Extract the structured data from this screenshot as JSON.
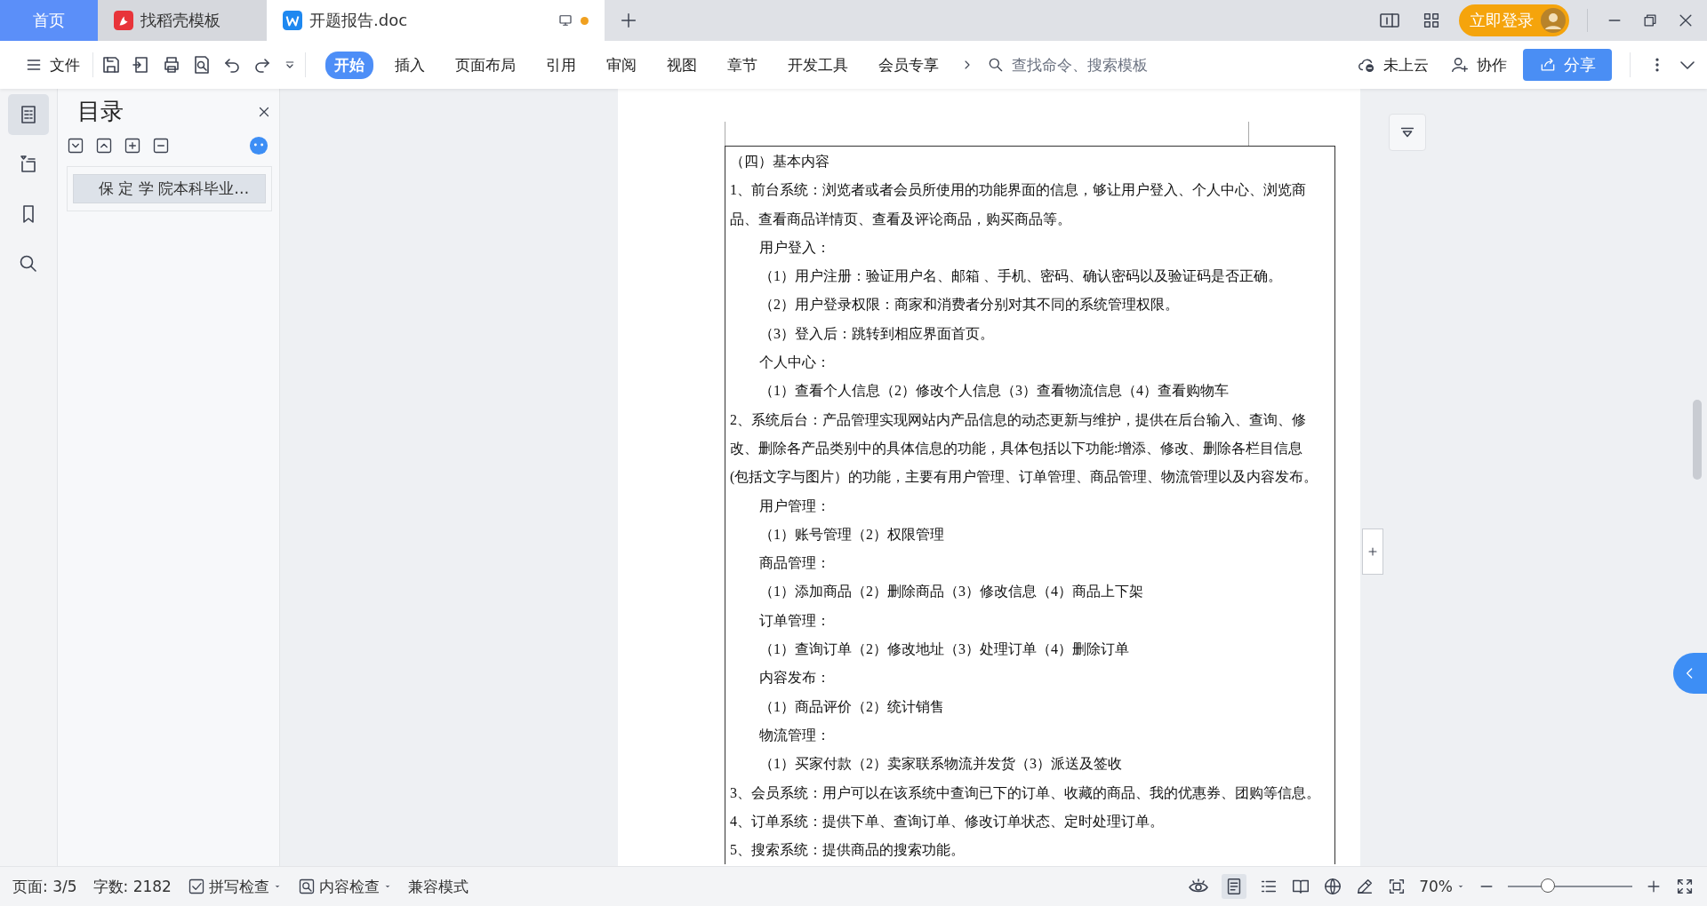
{
  "tabs": [
    {
      "label": "首页",
      "kind": "home",
      "selected": false
    },
    {
      "label": "找稻壳模板",
      "kind": "template",
      "selected": false
    },
    {
      "label": "开题报告.doc",
      "kind": "doc",
      "selected": true,
      "unsaved": true
    }
  ],
  "title_bar": {
    "login_button": "立即登录"
  },
  "toolbar": {
    "file_menu": "文件",
    "ribbon_tabs": [
      {
        "label": "开始",
        "selected": true
      },
      {
        "label": "插入",
        "selected": false
      },
      {
        "label": "页面布局",
        "selected": false
      },
      {
        "label": "引用",
        "selected": false
      },
      {
        "label": "审阅",
        "selected": false
      },
      {
        "label": "视图",
        "selected": false
      },
      {
        "label": "章节",
        "selected": false
      },
      {
        "label": "开发工具",
        "selected": false
      },
      {
        "label": "会员专享",
        "selected": false
      }
    ],
    "search": {
      "placeholder": "查找命令、搜索模板"
    },
    "cloud": "未上云",
    "collab": "协作",
    "share": "分享"
  },
  "nav_pane": {
    "title": "目录",
    "entries": [
      {
        "label": "保 定 学 院本科毕业…",
        "selected": true
      }
    ]
  },
  "document": {
    "paragraphs": [
      {
        "kind": "plain",
        "lines": [
          "（四）基本内容"
        ]
      },
      {
        "kind": "plain",
        "lines": [
          "1、前台系统：浏览者或者会员所使用的功能界面的信息，够让用户登入、个人中心、浏览商",
          "品、查看商品详情页、查看及评论商品，购买商品等。"
        ]
      },
      {
        "kind": "heading",
        "lines": [
          "用户登入："
        ]
      },
      {
        "kind": "item",
        "lines": [
          "（1）用户注册：验证用户名、邮箱 、手机、密码、确认密码以及验证码是否正确。"
        ]
      },
      {
        "kind": "item",
        "lines": [
          "（2）用户登录权限：商家和消费者分别对其不同的系统管理权限。"
        ]
      },
      {
        "kind": "item",
        "lines": [
          "（3）登入后：跳转到相应界面首页。"
        ]
      },
      {
        "kind": "heading",
        "lines": [
          "个人中心："
        ]
      },
      {
        "kind": "item",
        "lines": [
          "（1）查看个人信息（2）修改个人信息（3）查看物流信息（4）查看购物车"
        ]
      },
      {
        "kind": "plain",
        "lines": [
          "2、系统后台：产品管理实现网站内产品信息的动态更新与维护，提供在后台输入、查询、修",
          "改、删除各产品类别中的具体信息的功能，具体包括以下功能:增添、修改、删除各栏目信息",
          "(包括文字与图片）的功能，主要有用户管理、订单管理、商品管理、物流管理以及内容发布。"
        ]
      },
      {
        "kind": "heading",
        "lines": [
          "用户管理："
        ]
      },
      {
        "kind": "item",
        "lines": [
          "（1）账号管理（2）权限管理"
        ]
      },
      {
        "kind": "heading",
        "lines": [
          "商品管理："
        ]
      },
      {
        "kind": "item",
        "lines": [
          "（1）添加商品（2）删除商品（3）修改信息（4）商品上下架"
        ]
      },
      {
        "kind": "heading",
        "lines": [
          "订单管理："
        ]
      },
      {
        "kind": "item",
        "lines": [
          "（1）查询订单（2）修改地址（3）处理订单（4）删除订单"
        ]
      },
      {
        "kind": "heading",
        "lines": [
          "内容发布："
        ]
      },
      {
        "kind": "item",
        "lines": [
          "（1）商品评价（2）统计销售"
        ]
      },
      {
        "kind": "heading",
        "lines": [
          "物流管理："
        ]
      },
      {
        "kind": "item",
        "lines": [
          "（1）买家付款（2）卖家联系物流并发货（3）派送及签收"
        ]
      },
      {
        "kind": "plain",
        "lines": [
          "3、会员系统：用户可以在该系统中查询已下的订单、收藏的商品、我的优惠券、团购等信息。"
        ]
      },
      {
        "kind": "plain",
        "lines": [
          "4、订单系统：提供下单、查询订单、修改订单状态、定时处理订单。"
        ]
      },
      {
        "kind": "plain",
        "lines": [
          "5、搜索系统：提供商品的搜索功能。"
        ]
      }
    ]
  },
  "status_bar": {
    "page": "页面: 3/5",
    "words": "字数: 2182",
    "spell_check": "拼写检查",
    "content_check": "内容检查",
    "compat": "兼容模式",
    "zoom": "70%",
    "zoom_slider": {
      "level": 0.32
    }
  }
}
